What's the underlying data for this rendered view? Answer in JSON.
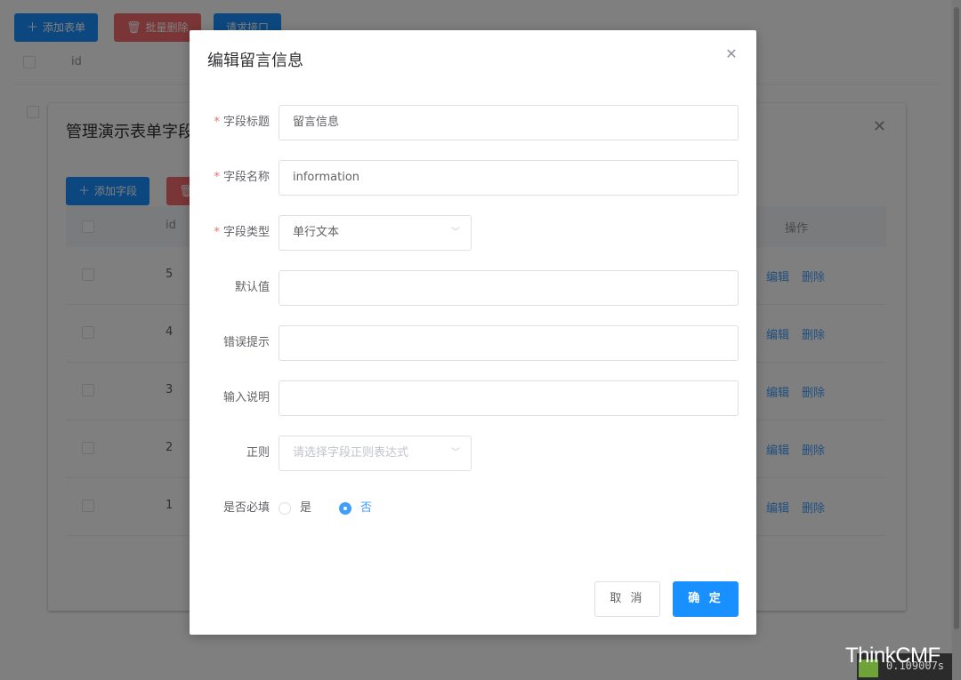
{
  "background": {
    "toolbar": {
      "add_form": "添加表单",
      "batch_delete": "批量删除",
      "request_api": "请求接口"
    },
    "table": {
      "col_id": "id"
    }
  },
  "inner_dialog": {
    "title": "管理演示表单字段",
    "add_field": "添加字段",
    "table": {
      "col_id": "id",
      "col_actions": "操作",
      "rows": [
        {
          "id": "5",
          "edit": "编辑",
          "delete": "删除"
        },
        {
          "id": "4",
          "edit": "编辑",
          "delete": "删除"
        },
        {
          "id": "3",
          "edit": "编辑",
          "delete": "删除"
        },
        {
          "id": "2",
          "edit": "编辑",
          "delete": "删除"
        },
        {
          "id": "1",
          "edit": "编辑",
          "delete": "删除"
        }
      ]
    }
  },
  "edit_dialog": {
    "title": "编辑留言信息",
    "fields": {
      "field_title": {
        "label": "字段标题",
        "required": true,
        "value": "留言信息"
      },
      "field_name": {
        "label": "字段名称",
        "required": true,
        "value": "information"
      },
      "field_type": {
        "label": "字段类型",
        "required": true,
        "value": "单行文本"
      },
      "default_value": {
        "label": "默认值",
        "value": ""
      },
      "error_hint": {
        "label": "错误提示",
        "value": ""
      },
      "input_desc": {
        "label": "输入说明",
        "value": ""
      },
      "regex": {
        "label": "正则",
        "placeholder": "请选择字段正则表达式"
      },
      "required_flag": {
        "label": "是否必填",
        "options": [
          "是",
          "否"
        ],
        "selected": "否"
      }
    },
    "cancel_label": "取 消",
    "confirm_label": "确 定"
  },
  "branding": {
    "text": "ThinkCMF",
    "timer": "0.109007s"
  },
  "colors": {
    "primary": "#1890ff",
    "danger": "#f56c6c",
    "link": "#409eff"
  }
}
